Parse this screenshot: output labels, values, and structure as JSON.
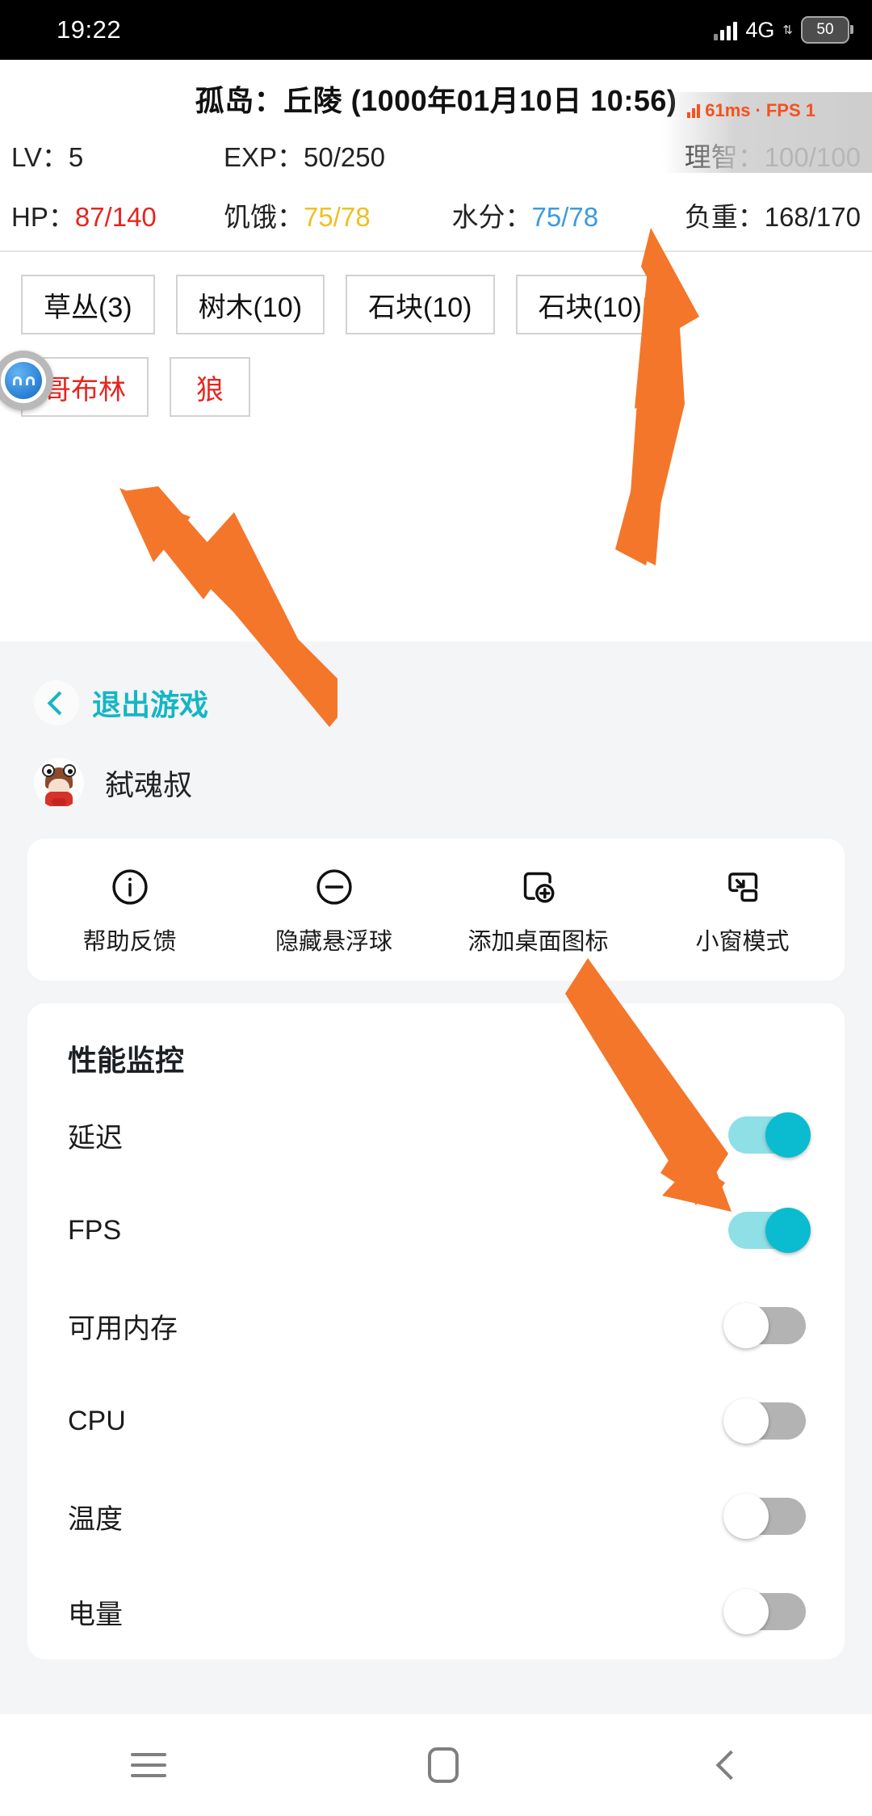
{
  "status_bar": {
    "time": "19:22",
    "network": "4G",
    "battery": "50",
    "signal_icon": "signal-bars-icon",
    "data_arrows": "⇅"
  },
  "game": {
    "title": "孤岛：丘陵 (1000年01月10日 10:56)",
    "perf_overlay": {
      "latency": "61ms",
      "separator": "·",
      "fps": "FPS 1"
    },
    "stats_row1": [
      {
        "label": "LV：",
        "value": "5",
        "color": "#222222"
      },
      {
        "label": "EXP：",
        "value": "50/250",
        "color": "#222222"
      },
      {
        "label": "理智：",
        "value": "100/100",
        "color": "#222222"
      }
    ],
    "stats_row2": [
      {
        "label": "HP：",
        "value": "87/140",
        "color": "#e8251f"
      },
      {
        "label": "饥饿：",
        "value": "75/78",
        "color": "#efc020"
      },
      {
        "label": "水分：",
        "value": "75/78",
        "color": "#3d9ae0"
      },
      {
        "label": "负重：",
        "value": "168/170",
        "color": "#222222"
      }
    ],
    "resource_buttons": [
      "草丛(3)",
      "树木(10)",
      "石块(10)",
      "石块(10)"
    ],
    "enemy_buttons": [
      "哥布林",
      "狼"
    ],
    "floating_ball": "floating-ball-icon"
  },
  "panel": {
    "exit_label": "退出游戏",
    "back_icon": "chevron-left-icon",
    "username": "弑魂叔",
    "avatar": "user-avatar",
    "quick_actions": [
      {
        "icon": "info-circle-icon",
        "label": "帮助反馈"
      },
      {
        "icon": "minus-circle-icon",
        "label": "隐藏悬浮球"
      },
      {
        "icon": "add-shortcut-icon",
        "label": "添加桌面图标"
      },
      {
        "icon": "small-window-icon",
        "label": "小窗模式"
      }
    ],
    "section_title": "性能监控",
    "toggles": [
      {
        "label": "延迟",
        "state": "on"
      },
      {
        "label": "FPS",
        "state": "on"
      },
      {
        "label": "可用内存",
        "state": "off"
      },
      {
        "label": "CPU",
        "state": "off"
      },
      {
        "label": "温度",
        "state": "off"
      },
      {
        "label": "电量",
        "state": "off"
      }
    ]
  },
  "nav_bar": {
    "recents": "recents-icon",
    "home": "home-icon",
    "back": "back-icon"
  },
  "annotations": {
    "arrow_color": "#f4762a",
    "arrows": [
      "arrow-to-weight-stat",
      "arrow-to-enemy-buttons",
      "arrow-to-latency-toggle"
    ]
  }
}
